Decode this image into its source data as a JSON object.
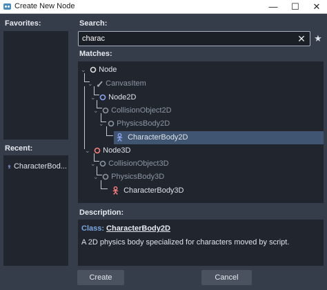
{
  "window": {
    "title": "Create New Node",
    "min_symbol": "—",
    "max_symbol": "☐",
    "close_symbol": "✕"
  },
  "favorites": {
    "label": "Favorites:"
  },
  "recent": {
    "label": "Recent:",
    "items": [
      {
        "label": "CharacterBod...",
        "icon": "character-body-2d-icon"
      }
    ]
  },
  "search": {
    "label": "Search:",
    "value": "charac",
    "clear_symbol": "✕",
    "favorite_symbol": "★"
  },
  "matches": {
    "label": "Matches:",
    "tree": [
      {
        "label": "Node",
        "icon": "node-icon",
        "dim": false,
        "expanded": true,
        "selected": false
      },
      {
        "label": "CanvasItem",
        "icon": "canvas-item-icon",
        "dim": true,
        "expanded": true,
        "selected": false
      },
      {
        "label": "Node2D",
        "icon": "node-2d-icon",
        "dim": false,
        "expanded": true,
        "selected": false
      },
      {
        "label": "CollisionObject2D",
        "icon": "collision-object-2d-icon",
        "dim": true,
        "expanded": true,
        "selected": false
      },
      {
        "label": "PhysicsBody2D",
        "icon": "physics-body-2d-icon",
        "dim": true,
        "expanded": true,
        "selected": false
      },
      {
        "label": "CharacterBody2D",
        "icon": "character-body-2d-icon",
        "dim": false,
        "expanded": false,
        "selected": true
      },
      {
        "label": "Node3D",
        "icon": "node-3d-icon",
        "dim": false,
        "expanded": true,
        "selected": false
      },
      {
        "label": "CollisionObject3D",
        "icon": "collision-object-3d-icon",
        "dim": true,
        "expanded": true,
        "selected": false
      },
      {
        "label": "PhysicsBody3D",
        "icon": "physics-body-3d-icon",
        "dim": true,
        "expanded": true,
        "selected": false
      },
      {
        "label": "CharacterBody3D",
        "icon": "character-body-3d-icon",
        "dim": false,
        "expanded": false,
        "selected": false
      }
    ]
  },
  "description": {
    "label": "Description:",
    "class_keyword": "Class:",
    "class_name": "CharacterBody2D",
    "text": "A 2D physics body specialized for characters moved by script."
  },
  "buttons": {
    "create": "Create",
    "cancel": "Cancel"
  },
  "colors": {
    "background": "#363d4a",
    "panel": "#21262e",
    "selection": "#3f5572",
    "accent_2d": "#8da5f3",
    "accent_3d": "#fc7f7f",
    "class_keyword": "#7ba8e4"
  }
}
